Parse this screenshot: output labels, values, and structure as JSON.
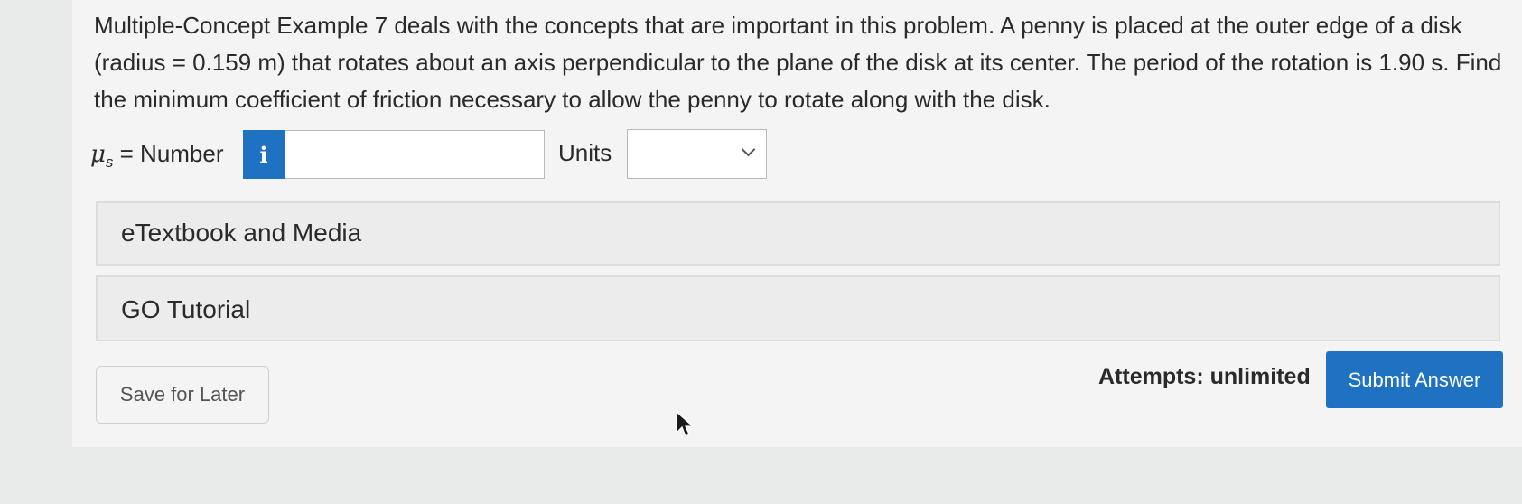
{
  "question": {
    "text": "Multiple-Concept Example 7 deals with the concepts that are important in this problem. A penny is placed at the outer edge of a disk (radius = 0.159 m) that rotates about an axis perpendicular to the plane of the disk at its center. The period of the rotation is 1.90 s. Find the minimum coefficient of friction necessary to allow the penny to rotate along with the disk."
  },
  "answer": {
    "symbol": "μ",
    "subscript": "s",
    "label_suffix": " = Number",
    "info_icon": "i",
    "number_value": "",
    "units_label": "Units",
    "units_selected": ""
  },
  "panels": {
    "etextbook": "eTextbook and Media",
    "go_tutorial": "GO Tutorial"
  },
  "footer": {
    "save_label": "Save for Later",
    "attempts": "Attempts: unlimited",
    "submit_label": "Submit Answer"
  },
  "colors": {
    "accent": "#1f72c2"
  },
  "icons": {
    "info": "info-icon",
    "dropdown": "chevron-down-icon",
    "cursor": "mouse-cursor-icon"
  }
}
